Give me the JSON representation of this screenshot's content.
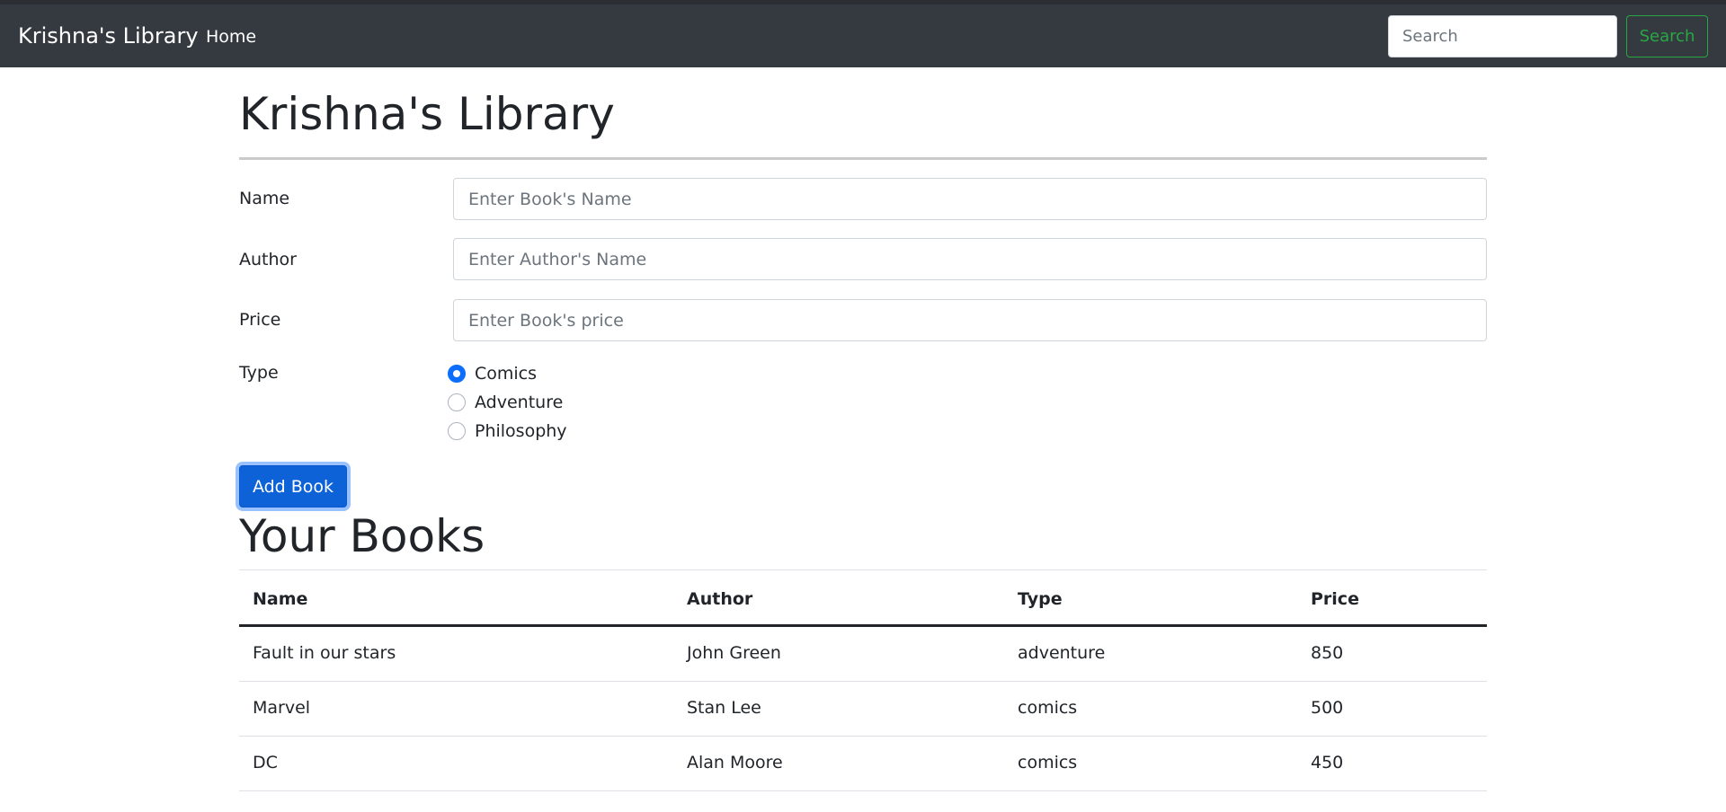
{
  "navbar": {
    "brand": "Krishna's Library",
    "home_label": "Home",
    "search_placeholder": "Search",
    "search_button": "Search"
  },
  "page": {
    "title": "Krishna's Library"
  },
  "form": {
    "name_label": "Name",
    "name_placeholder": "Enter Book's Name",
    "author_label": "Author",
    "author_placeholder": "Enter Author's Name",
    "price_label": "Price",
    "price_placeholder": "Enter Book's price",
    "type_label": "Type",
    "type_options": [
      {
        "label": "Comics",
        "checked": true
      },
      {
        "label": "Adventure",
        "checked": false
      },
      {
        "label": "Philosophy",
        "checked": false
      }
    ],
    "submit_label": "Add Book"
  },
  "books": {
    "title": "Your Books",
    "columns": [
      "Name",
      "Author",
      "Type",
      "Price"
    ],
    "rows": [
      [
        "Fault in our stars",
        "John Green",
        "adventure",
        "850"
      ],
      [
        "Marvel",
        "Stan Lee",
        "comics",
        "500"
      ],
      [
        "DC",
        "Alan Moore",
        "comics",
        "450"
      ]
    ]
  },
  "colors": {
    "navbar_bg": "#343a40",
    "primary": "#0d6efd",
    "success": "#28a745"
  }
}
